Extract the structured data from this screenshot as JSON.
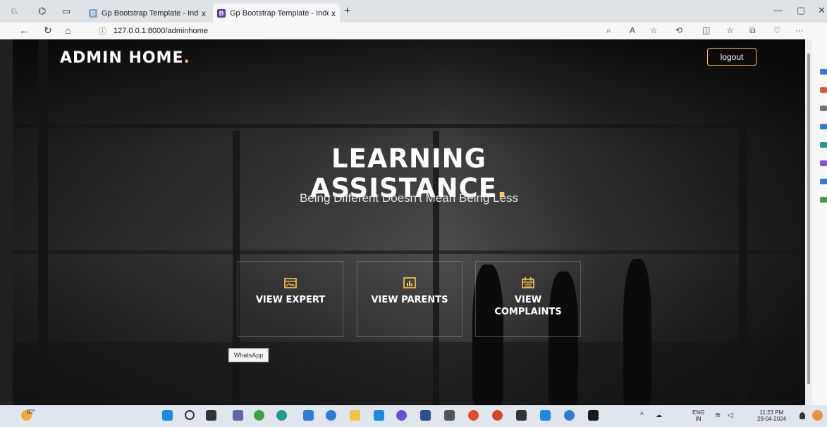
{
  "browser": {
    "tabs": [
      {
        "title": "Gp Bootstrap Template - Index",
        "fav": "B"
      },
      {
        "title": "Gp Bootstrap Template - Index",
        "fav": "B"
      }
    ],
    "new_tab": "+",
    "close": "x",
    "url": "127.0.0.1:8000/adminhome"
  },
  "page": {
    "brand": "ADMIN HOME",
    "brand_dot": ".",
    "logout": "logout",
    "hero_line1": "LEARNING",
    "hero_line2": "ASSISTANCE",
    "hero_dot": ".",
    "subtitle": "Being Different Doesn't Mean Being Less",
    "cards": [
      {
        "label": "VIEW EXPERT",
        "icon": "calendar-picture-icon"
      },
      {
        "label": "VIEW PARENTS",
        "icon": "bar-chart-icon"
      },
      {
        "label": "VIEW\nCOMPLAINTS",
        "icon": "calendar-icon"
      }
    ],
    "whatsapp_tooltip": "WhatsApp",
    "accent": "#ffc451"
  },
  "taskbar": {
    "weather": "82°",
    "lang1": "ENG",
    "lang2": "IN",
    "time": "11:23 PM",
    "date": "29-04-2024"
  }
}
